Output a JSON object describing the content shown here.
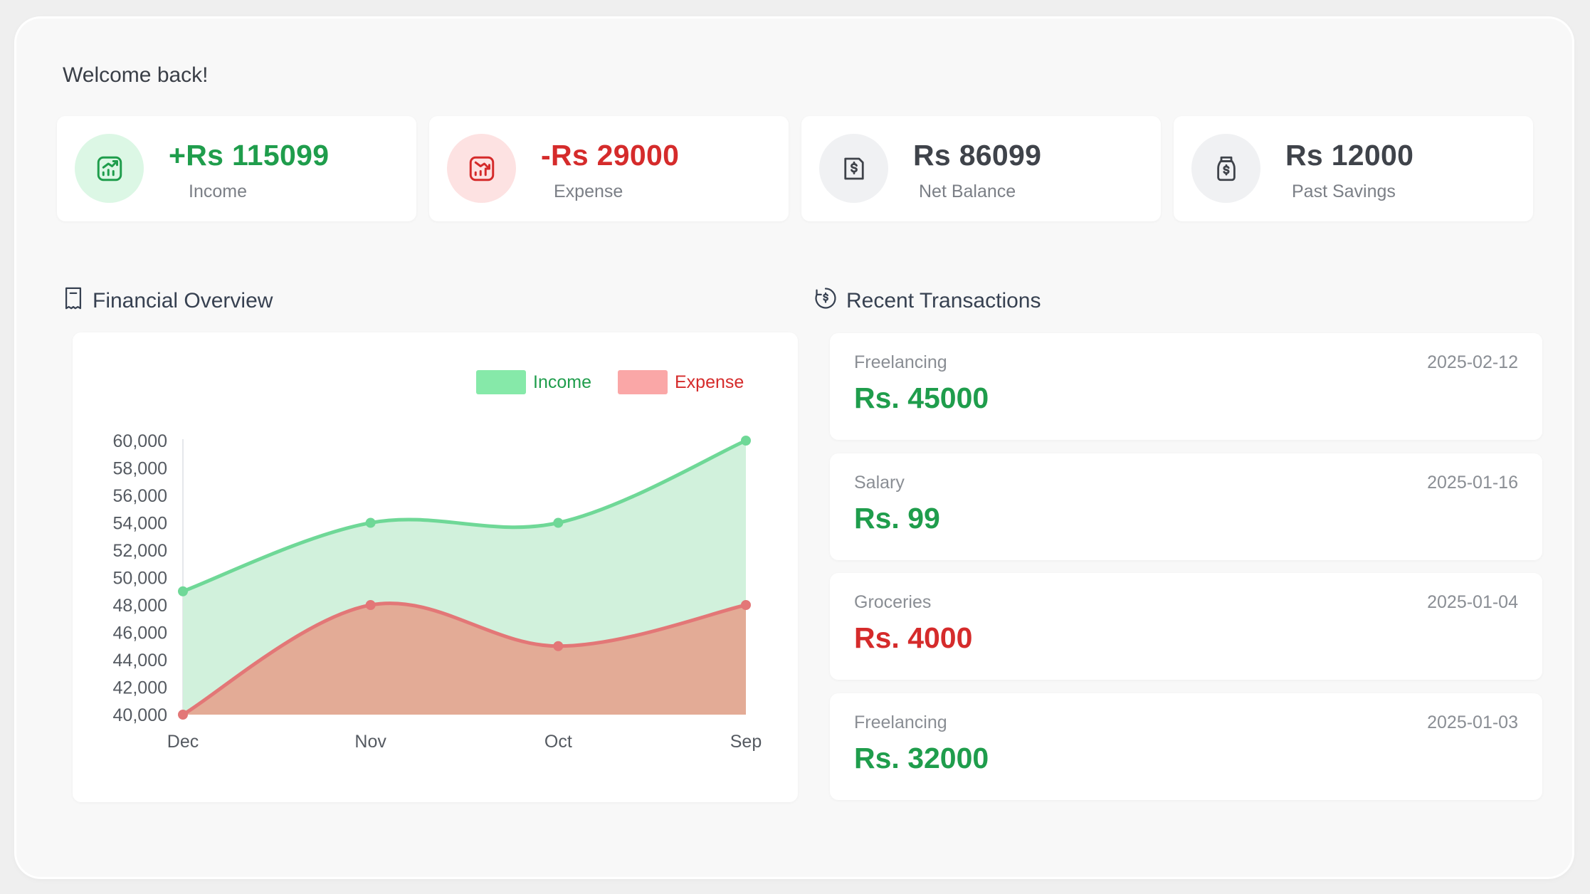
{
  "header": {
    "welcome": "Welcome back!"
  },
  "stats": [
    {
      "value": "+Rs 115099",
      "label": "Income",
      "icon": "chart-up-icon",
      "color": "#1f9d4c",
      "icon_bg": "#dcf7e5"
    },
    {
      "value": "-Rs 29000",
      "label": "Expense",
      "icon": "chart-down-icon",
      "color": "#d52b2b",
      "icon_bg": "#fde2e2"
    },
    {
      "value": "Rs 86099",
      "label": "Net Balance",
      "icon": "receipt-dollar-icon",
      "color": "#3f434a",
      "icon_bg": "#f0f1f3"
    },
    {
      "value": "Rs 12000",
      "label": "Past Savings",
      "icon": "money-jar-icon",
      "color": "#3f434a",
      "icon_bg": "#f0f1f3"
    }
  ],
  "overview": {
    "title": "Financial Overview"
  },
  "transactions_section": {
    "title": "Recent Transactions"
  },
  "transactions": [
    {
      "category": "Freelancing",
      "date": "2025-02-12",
      "amount": "Rs. 45000",
      "type": "income"
    },
    {
      "category": "Salary",
      "date": "2025-01-16",
      "amount": "Rs. 99",
      "type": "income"
    },
    {
      "category": "Groceries",
      "date": "2025-01-04",
      "amount": "Rs. 4000",
      "type": "expense"
    },
    {
      "category": "Freelancing",
      "date": "2025-01-03",
      "amount": "Rs. 32000",
      "type": "income"
    }
  ],
  "colors": {
    "income": "#1f9d4c",
    "expense": "#d52b2b",
    "income_line": "#6fd897",
    "income_fill": "#d1f1dc",
    "expense_line": "#e37777",
    "expense_fill": "#e3ab96",
    "income_legend": "#86e9a9",
    "expense_legend": "#faa7a7"
  },
  "chart_data": {
    "type": "area",
    "categories": [
      "Dec",
      "Nov",
      "Oct",
      "Sep"
    ],
    "series": [
      {
        "name": "Income",
        "values": [
          49000,
          54000,
          54000,
          60000
        ]
      },
      {
        "name": "Expense",
        "values": [
          40000,
          48000,
          45000,
          48000
        ]
      }
    ],
    "ylim": [
      40000,
      60000
    ],
    "yticks": [
      "60,000",
      "58,000",
      "56,000",
      "54,000",
      "52,000",
      "50,000",
      "48,000",
      "46,000",
      "44,000",
      "42,000",
      "40,000"
    ],
    "legend": "top-right"
  }
}
